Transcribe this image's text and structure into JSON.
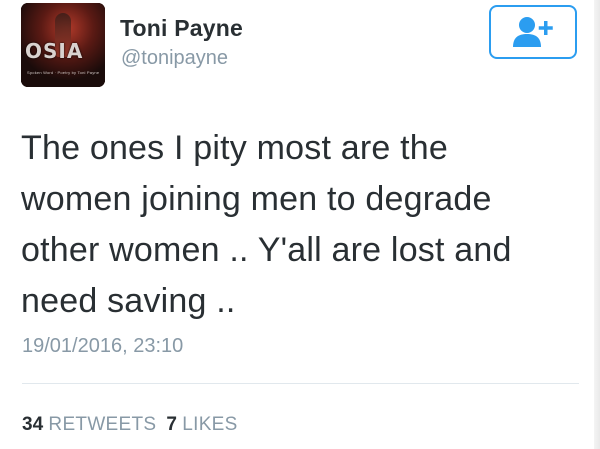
{
  "user": {
    "display_name": "Toni Payne",
    "handle": "@tonipayne",
    "avatar": {
      "logo_text": "OSIA",
      "tagline": "Spoken Word · Poetry by Toni Payne"
    }
  },
  "follow_button": {
    "icon": "add-user-icon",
    "accent_color": "#2b9df0"
  },
  "tweet": {
    "text_lines": [
      "The ones I pity most are the",
      "women joining men to degrade",
      "other women .. Y'all are lost and",
      "need saving .."
    ],
    "timestamp": "19/01/2016, 23:10"
  },
  "stats": {
    "retweets_count": "34",
    "retweets_label": "RETWEETS",
    "likes_count": "7",
    "likes_label": "LIKES"
  }
}
